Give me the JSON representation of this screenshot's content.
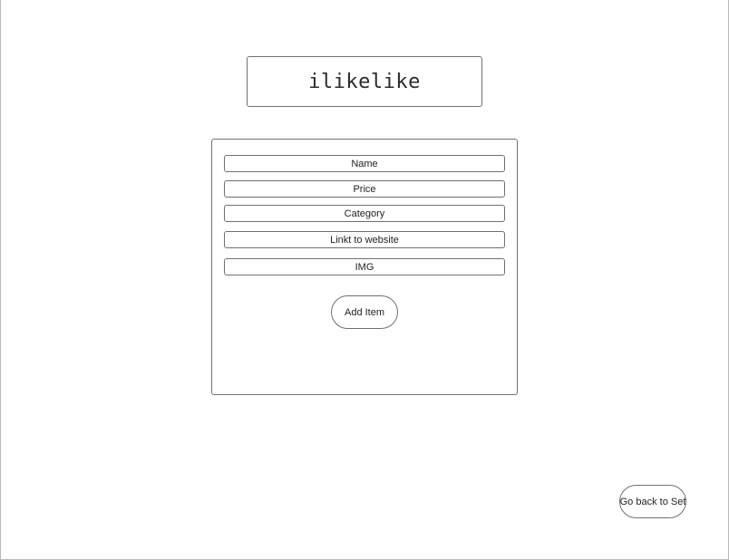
{
  "header": {
    "logo_text": "ilikelike"
  },
  "form": {
    "fields": [
      {
        "label": "Name"
      },
      {
        "label": "Price"
      },
      {
        "label": "Category"
      },
      {
        "label": "Linkt to website"
      },
      {
        "label": "IMG"
      }
    ],
    "add_button_label": "Add Item"
  },
  "footer": {
    "back_button_label": "Go back to Set"
  }
}
